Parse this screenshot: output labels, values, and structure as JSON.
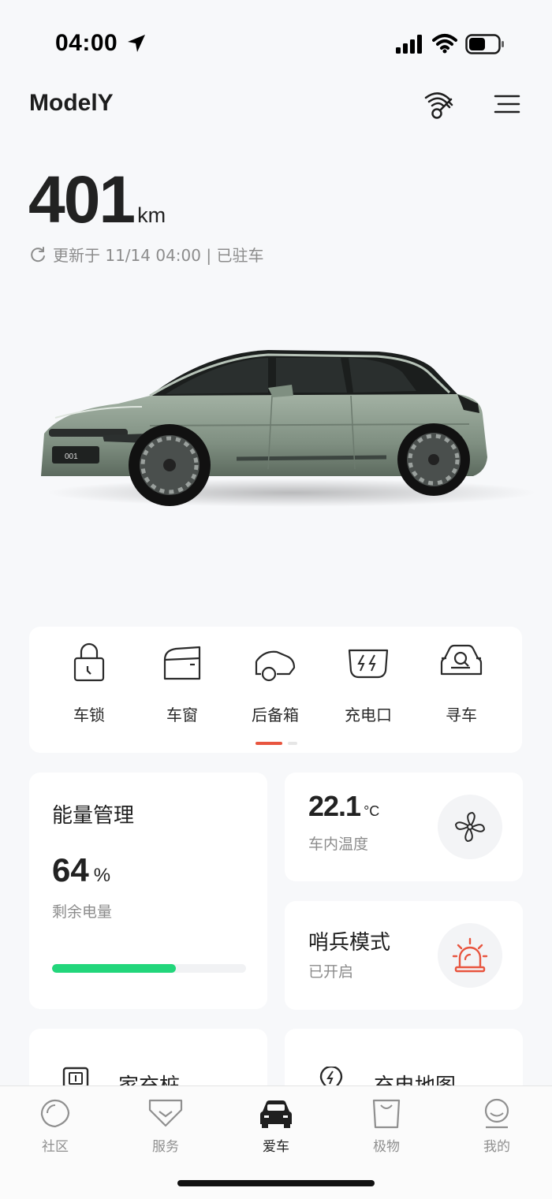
{
  "status_bar": {
    "time": "04:00"
  },
  "header": {
    "title": "ModelY"
  },
  "range": {
    "value": "401",
    "unit": "km",
    "updated_text": "更新于 11/14 04:00 | 已驻车"
  },
  "car": {
    "plate": "001",
    "body_color": "#8a9a8c"
  },
  "quick_controls": {
    "items": [
      {
        "label": "车锁",
        "icon": "lock-icon"
      },
      {
        "label": "车窗",
        "icon": "window-icon"
      },
      {
        "label": "后备箱",
        "icon": "trunk-icon"
      },
      {
        "label": "充电口",
        "icon": "charge-port-icon"
      },
      {
        "label": "寻车",
        "icon": "find-car-icon"
      }
    ],
    "page": 1,
    "page_count": 2
  },
  "energy": {
    "title": "能量管理",
    "value": "64",
    "unit": "%",
    "label": "剩余电量",
    "level": 0.64,
    "accent": "#22d67b"
  },
  "climate": {
    "value": "22.1",
    "unit": "°C",
    "label": "车内温度"
  },
  "sentry": {
    "title": "哨兵模式",
    "status": "已开启",
    "accent": "#e8553f"
  },
  "shortcuts": [
    {
      "title": "家充桩"
    },
    {
      "title": "充电地图"
    }
  ],
  "tabbar": {
    "items": [
      {
        "label": "社区",
        "icon": "community-icon"
      },
      {
        "label": "服务",
        "icon": "service-icon"
      },
      {
        "label": "爱车",
        "icon": "car-icon",
        "active": true
      },
      {
        "label": "极物",
        "icon": "shop-icon"
      },
      {
        "label": "我的",
        "icon": "profile-icon"
      }
    ]
  }
}
